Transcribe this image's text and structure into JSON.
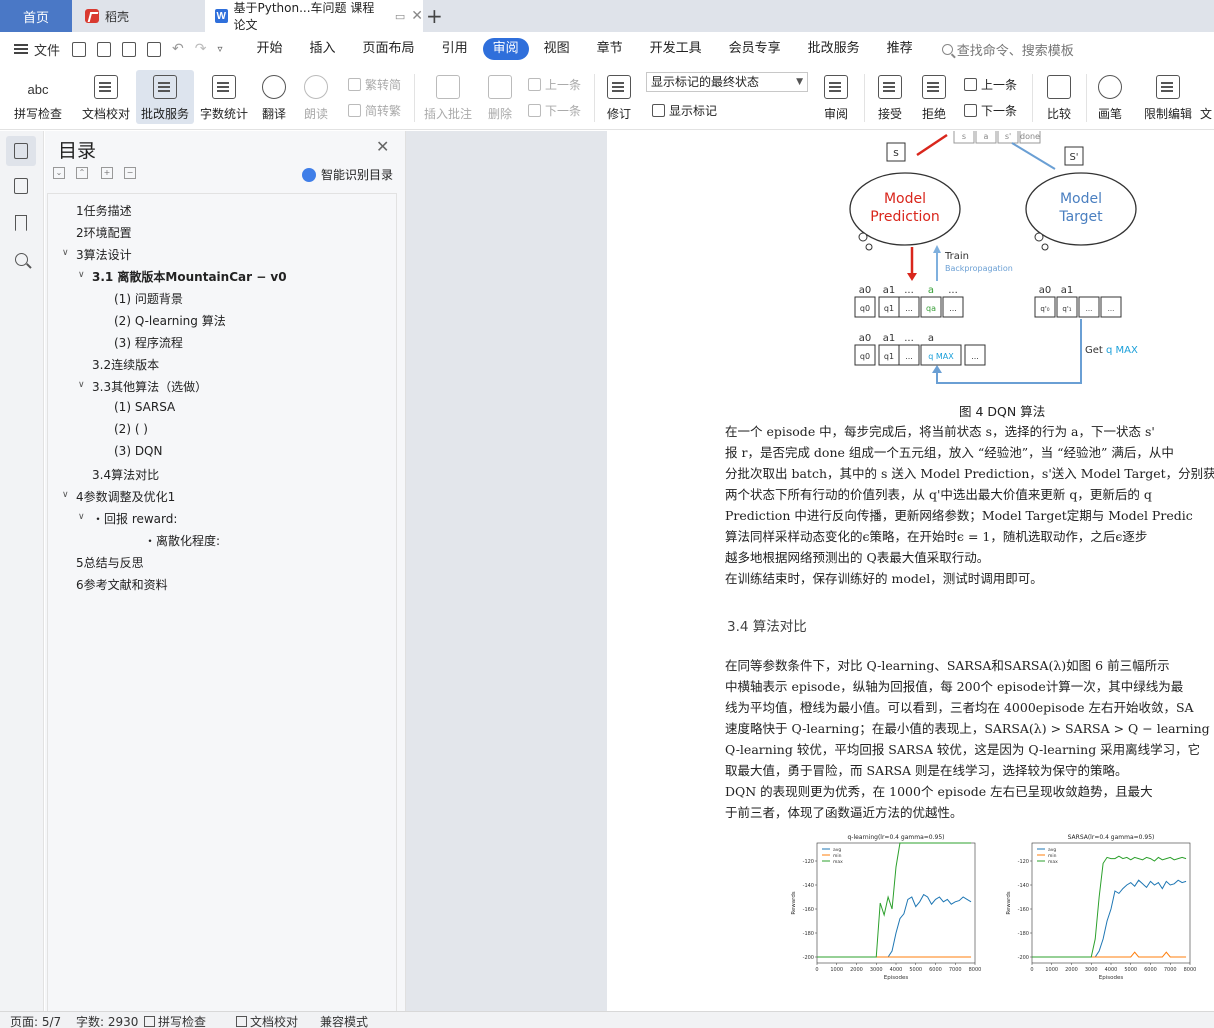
{
  "tabs": {
    "home": "首页",
    "daoke": "稻壳",
    "doc": "基于Python...车问题 课程论文"
  },
  "menu": {
    "file": "文件",
    "items": [
      "开始",
      "插入",
      "页面布局",
      "引用",
      "审阅",
      "视图",
      "章节",
      "开发工具",
      "会员专享",
      "批改服务",
      "推荐"
    ],
    "active": "审阅",
    "search": "查找命令、搜索模板"
  },
  "ribbon": {
    "spell_check": "拼写检查",
    "doc_proof": "文档校对",
    "grading": "批改服务",
    "word_count": "字数统计",
    "translate": "翻译",
    "read_aloud": "朗读",
    "trad_to_simp": "繁转简",
    "simp_to_trad": "简转繁",
    "insert_comment": "插入批注",
    "delete": "删除",
    "prev_comment": "上一条",
    "next_comment": "下一条",
    "track_changes": "修订",
    "markup_select": "显示标记的最终状态",
    "show_markup": "显示标记",
    "review": "审阅",
    "accept": "接受",
    "reject": "拒绝",
    "prev": "上一条",
    "next": "下一条",
    "compare": "比较",
    "pen": "画笔",
    "restrict_edit": "限制编辑",
    "more": "文"
  },
  "toc": {
    "title": "目录",
    "smart": "智能识别目录",
    "items": [
      {
        "text": "1任务描述"
      },
      {
        "text": "2环境配置"
      },
      {
        "text": "3算法设计"
      },
      {
        "text": "3.1 离散版本MountainCar − v0"
      },
      {
        "text": "(1) 问题背景"
      },
      {
        "text": "(2) Q-learning 算法"
      },
      {
        "text": "(3) 程序流程"
      },
      {
        "text": "3.2连续版本"
      },
      {
        "text": "3.3其他算法（选做）"
      },
      {
        "text": "(1) SARSA"
      },
      {
        "text": "(2)                 (   )"
      },
      {
        "text": "(3) DQN"
      },
      {
        "text": "3.4算法对比"
      },
      {
        "text": "4参数调整及优化1"
      },
      {
        "text": "・回报 reward:"
      },
      {
        "text": "・离散化程度:"
      },
      {
        "text": "5总结与反思"
      },
      {
        "text": "6参考文献和资料"
      }
    ]
  },
  "diagram": {
    "s_label": "s",
    "s_prime_label": "S'",
    "model_prediction": [
      "Model",
      "Prediction"
    ],
    "model_target": [
      "Model",
      "Target"
    ],
    "train": "Train",
    "backprop": "Backpropagation",
    "get_q_max": [
      "Get ",
      "q MAX"
    ],
    "top_actions": [
      "a0",
      "a1",
      "...",
      "a",
      "..."
    ],
    "top_q": [
      "q0",
      "q1",
      "...",
      "qa",
      "..."
    ],
    "right_actions": [
      "a0",
      "a1"
    ],
    "right_q": [
      "q'₀",
      "q'₁",
      "...",
      "..."
    ],
    "bottom_actions": [
      "a0",
      "a1",
      "...",
      "a"
    ],
    "bottom_q": [
      "q0",
      "q1",
      "...",
      "q MAX",
      "..."
    ],
    "tuple": [
      "s",
      "a",
      "s'",
      "done"
    ]
  },
  "document": {
    "figure_caption": "图 4 DQN 算法",
    "paragraphs": [
      "    在一个 episode 中，每步完成后，将当前状态 s，选择的行为 a，下一状态 s'",
      "报 r，是否完成 done 组成一个五元组，放入 “经验池”，当 “经验池” 满后，从中",
      "分批次取出 batch，其中的 s 送入 Model Prediction，s'送入 Model Target，分别获",
      "    两个状态下所有行动的价值列表，从 q'中选出最大价值来更新 q，更新后的 q",
      "  Prediction 中进行反向传播，更新网络参数；Model Target定期与 Model Predic",
      "    算法同样采样动态变化的ϵ策略，在开始时ϵ = 1，随机选取动作，之后ϵ逐步",
      "越多地根据网络预测出的 Q表最大值采取行动。",
      "    在训练结束时，保存训练好的 model，测试时调用即可。"
    ],
    "section_heading": "3.4 算法对比",
    "paragraphs2": [
      "    在同等参数条件下，对比 Q-learning、SARSA和SARSA(λ)如图 6 前三幅所示",
      "中横轴表示 episode，纵轴为回报值，每 200个 episode计算一次，其中绿线为最",
      "线为平均值，橙线为最小值。可以看到，三者均在 4000episode 左右开始收敛，SA",
      "速度略快于 Q-learning；在最小值的表现上，SARSA(λ) > SARSA > Q − learning",
      "Q-learning 较优，平均回报 SARSA 较优，这是因为 Q-learning 采用离线学习，它",
      "取最大值，勇于冒险，而 SARSA 则是在线学习，选择较为保守的策略。",
      "    DQN 的表现则更为优秀，在 1000个 episode 左右已呈现收敛趋势，且最大",
      "于前三者，体现了函数逼近方法的优越性。"
    ]
  },
  "chart_data": [
    {
      "type": "line",
      "title": "q-learning(lr=0.4 gamma=0.95)",
      "xlabel": "Episodes",
      "ylabel": "Rewards",
      "xlim": [
        0,
        8000
      ],
      "ylim": [
        -205,
        -105
      ],
      "xticks": [
        0,
        1000,
        2000,
        3000,
        4000,
        5000,
        6000,
        7000,
        8000
      ],
      "yticks": [
        -200,
        -180,
        -160,
        -140,
        -120
      ],
      "legend": "top-left",
      "x": [
        0,
        200,
        400,
        600,
        800,
        1000,
        1200,
        1400,
        1600,
        1800,
        2000,
        2200,
        2400,
        2600,
        2800,
        3000,
        3200,
        3400,
        3600,
        3800,
        4000,
        4200,
        4400,
        4600,
        4800,
        5000,
        5200,
        5400,
        5600,
        5800,
        6000,
        6200,
        6400,
        6600,
        6800,
        7000,
        7200,
        7400,
        7600,
        7800
      ],
      "series": [
        {
          "name": "avg",
          "color": "#1f77b4",
          "values": [
            -200,
            -200,
            -200,
            -200,
            -200,
            -200,
            -200,
            -200,
            -200,
            -200,
            -200,
            -200,
            -200,
            -200,
            -200,
            -200,
            -200,
            -200,
            -200,
            -195,
            -180,
            -168,
            -164,
            -152,
            -150,
            -158,
            -154,
            -148,
            -150,
            -156,
            -152,
            -150,
            -154,
            -152,
            -156,
            -154,
            -153,
            -150,
            -152,
            -154
          ]
        },
        {
          "name": "min",
          "color": "#ff7f0e",
          "values": [
            -200,
            -200,
            -200,
            -200,
            -200,
            -200,
            -200,
            -200,
            -200,
            -200,
            -200,
            -200,
            -200,
            -200,
            -200,
            -200,
            -200,
            -200,
            -200,
            -200,
            -200,
            -200,
            -200,
            -200,
            -200,
            -200,
            -200,
            -200,
            -200,
            -200,
            -200,
            -200,
            -200,
            -200,
            -200,
            -200,
            -200,
            -200,
            -200,
            -200
          ]
        },
        {
          "name": "max",
          "color": "#2ca02c",
          "values": [
            -200,
            -200,
            -200,
            -200,
            -200,
            -200,
            -200,
            -200,
            -200,
            -200,
            -200,
            -200,
            -200,
            -200,
            -200,
            -200,
            -155,
            -165,
            -150,
            -160,
            -125,
            -105,
            -105,
            -105,
            -105,
            -105,
            -105,
            -105,
            -105,
            -105,
            -105,
            -105,
            -105,
            -105,
            -105,
            -105,
            -105,
            -105,
            -105,
            -105
          ]
        }
      ]
    },
    {
      "type": "line",
      "title": "SARSA(lr=0.4 gamma=0.95)",
      "xlabel": "Episodes",
      "ylabel": "Rewards",
      "xlim": [
        0,
        8000
      ],
      "ylim": [
        -205,
        -105
      ],
      "xticks": [
        0,
        1000,
        2000,
        3000,
        4000,
        5000,
        6000,
        7000,
        8000
      ],
      "yticks": [
        -200,
        -180,
        -160,
        -140,
        -120
      ],
      "legend": "top-left",
      "x": [
        0,
        200,
        400,
        600,
        800,
        1000,
        1200,
        1400,
        1600,
        1800,
        2000,
        2200,
        2400,
        2600,
        2800,
        3000,
        3200,
        3400,
        3600,
        3800,
        4000,
        4200,
        4400,
        4600,
        4800,
        5000,
        5200,
        5400,
        5600,
        5800,
        6000,
        6200,
        6400,
        6600,
        6800,
        7000,
        7200,
        7400,
        7600,
        7800
      ],
      "series": [
        {
          "name": "avg",
          "color": "#1f77b4",
          "values": [
            -200,
            -200,
            -200,
            -200,
            -200,
            -200,
            -200,
            -200,
            -200,
            -200,
            -200,
            -200,
            -200,
            -200,
            -200,
            -200,
            -200,
            -195,
            -185,
            -170,
            -160,
            -145,
            -147,
            -143,
            -140,
            -138,
            -141,
            -136,
            -139,
            -142,
            -137,
            -140,
            -138,
            -143,
            -137,
            -140,
            -139,
            -136,
            -138,
            -137
          ]
        },
        {
          "name": "min",
          "color": "#ff7f0e",
          "values": [
            -200,
            -200,
            -200,
            -200,
            -200,
            -200,
            -200,
            -200,
            -200,
            -200,
            -200,
            -200,
            -200,
            -200,
            -200,
            -200,
            -200,
            -200,
            -200,
            -200,
            -200,
            -200,
            -200,
            -200,
            -200,
            -200,
            -196,
            -200,
            -200,
            -200,
            -200,
            -200,
            -200,
            -200,
            -196,
            -200,
            -200,
            -200,
            -200,
            -200
          ]
        },
        {
          "name": "max",
          "color": "#2ca02c",
          "values": [
            -200,
            -200,
            -200,
            -200,
            -200,
            -200,
            -200,
            -200,
            -200,
            -200,
            -200,
            -200,
            -200,
            -200,
            -200,
            -200,
            -185,
            -150,
            -122,
            -117,
            -118,
            -118,
            -116,
            -118,
            -117,
            -119,
            -117,
            -118,
            -119,
            -117,
            -118,
            -120,
            -117,
            -119,
            -118,
            -117,
            -119,
            -118,
            -117,
            -118
          ]
        }
      ]
    }
  ],
  "status": {
    "page": "页面: 5/7",
    "words": "字数: 2930",
    "spell": "拼写检查",
    "proof": "文档校对",
    "compat": "兼容模式"
  }
}
